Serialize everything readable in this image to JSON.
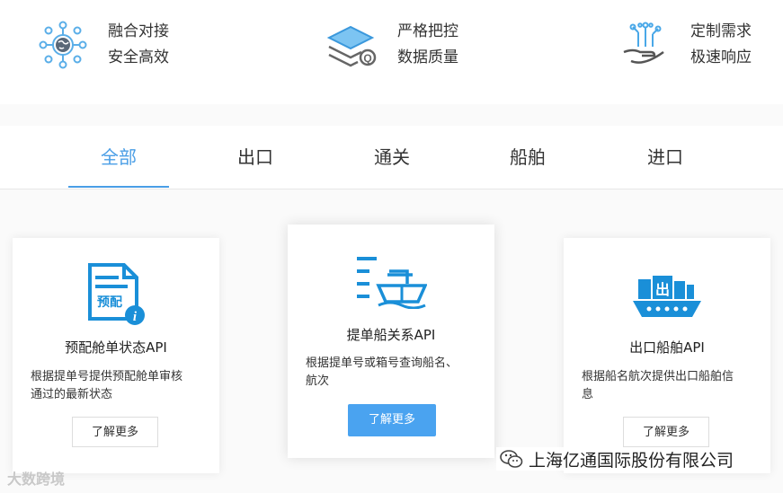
{
  "features": [
    {
      "icon": "globe-network-icon",
      "line1": "融合对接",
      "line2": "安全高效"
    },
    {
      "icon": "layers-search-icon",
      "line1": "严格把控",
      "line2": "数据质量"
    },
    {
      "icon": "hand-circuit-icon",
      "line1": "定制需求",
      "line2": "极速响应"
    }
  ],
  "tabs": [
    {
      "label": "全部",
      "active": true
    },
    {
      "label": "出口",
      "active": false
    },
    {
      "label": "通关",
      "active": false
    },
    {
      "label": "船舶",
      "active": false
    },
    {
      "label": "进口",
      "active": false
    }
  ],
  "cards": [
    {
      "icon": "document-info-icon",
      "icon_text": "预配",
      "title": "预配舱单状态API",
      "desc": [
        "根据提单号提供预配舱单审核",
        "通过的最新状态"
      ],
      "button": "了解更多"
    },
    {
      "icon": "ship-list-icon",
      "title": "提单船关系API",
      "desc": [
        "根据提单号或箱号查询船名、",
        "航次"
      ],
      "button": "了解更多"
    },
    {
      "icon": "container-ship-icon",
      "icon_text": "出",
      "title": "出口船舶API",
      "desc": [
        "根据船名航次提供出口船舶信",
        "息"
      ],
      "button": "了解更多"
    }
  ],
  "watermark": {
    "left_text": "大数跨境",
    "right_icon": "wechat-icon",
    "right_text": "上海亿通国际股份有限公司"
  },
  "colors": {
    "accent": "#4a9ee6",
    "button_primary": "#4aa3f0",
    "icon_blue": "#1a8fd8"
  }
}
